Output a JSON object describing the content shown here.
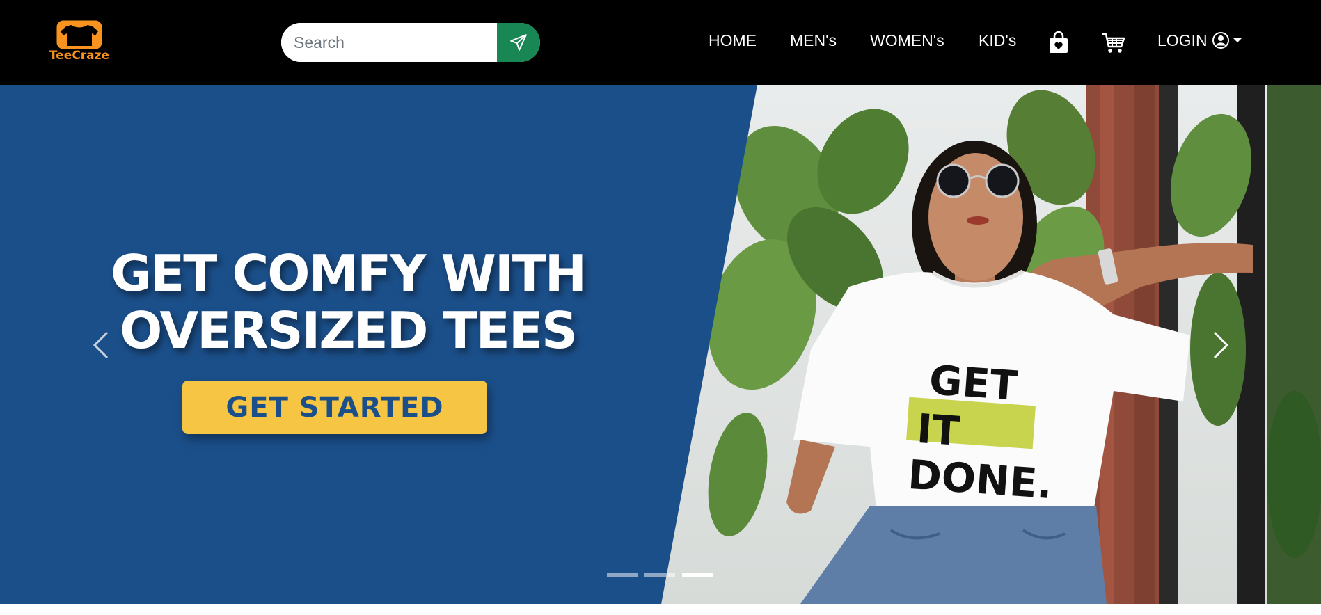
{
  "brand": {
    "name": "TeeCraze",
    "color": "#f7931e"
  },
  "search": {
    "placeholder": "Search",
    "value": "",
    "button_icon": "send-icon"
  },
  "nav": {
    "items": [
      {
        "label": "HOME"
      },
      {
        "label": "MEN's"
      },
      {
        "label": "WOMEN's"
      },
      {
        "label": "KID's"
      }
    ],
    "icons": [
      "shopping-bag-icon",
      "cart-icon"
    ],
    "login_label": "LOGIN"
  },
  "hero": {
    "headline_line1": "GET COMFY WITH",
    "headline_line2": "OVERSIZED TEES",
    "cta_label": "GET STARTED",
    "shirt_text": [
      "GET",
      "IT",
      "DONE."
    ],
    "slide_count": 3,
    "active_slide": 3,
    "colors": {
      "panel": "#1b4f8a",
      "cta": "#f6c543",
      "shirt_highlight": "#c8d44e"
    }
  },
  "colors": {
    "header_bg": "#000000",
    "search_button": "#198754"
  }
}
